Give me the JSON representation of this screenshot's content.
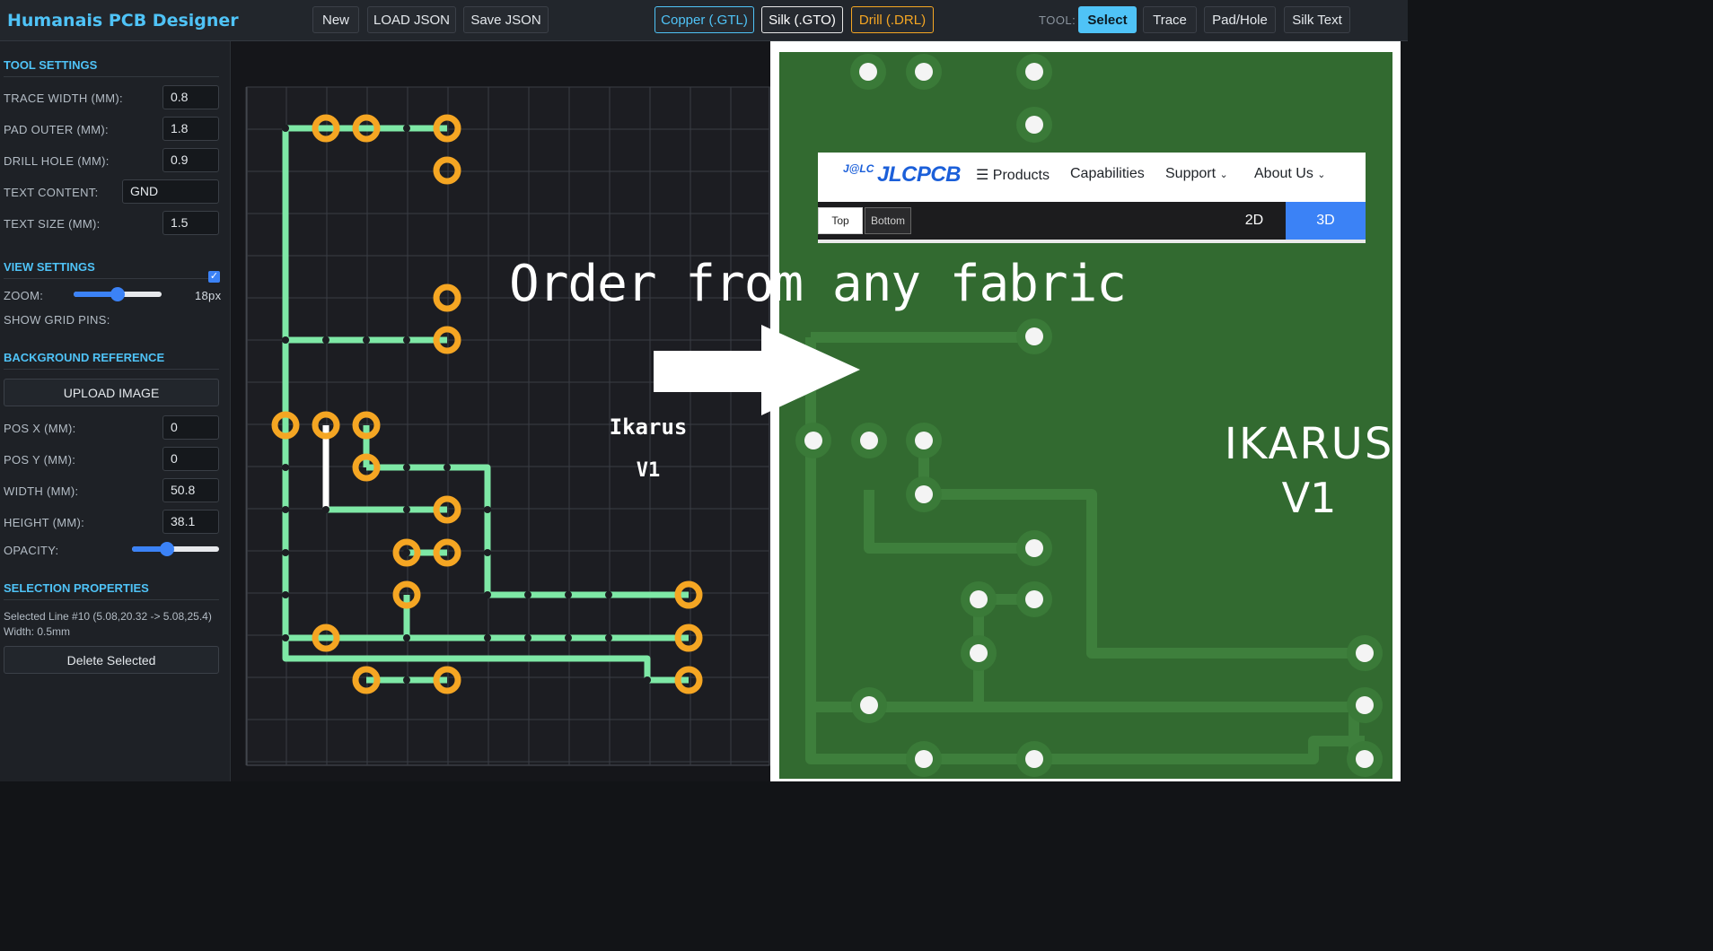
{
  "app": {
    "title": "Humanais PCB Designer"
  },
  "toolbar": {
    "new_label": "New",
    "load_label": "LOAD JSON",
    "save_label": "Save JSON",
    "layers": {
      "copper": "Copper (.GTL)",
      "silk": "Silk (.GTO)",
      "drill": "Drill (.DRL)"
    },
    "tool_label": "TOOL:",
    "tools": {
      "select": "Select",
      "trace": "Trace",
      "pad": "Pad/Hole",
      "silk_text": "Silk Text"
    },
    "active_tool": "Select"
  },
  "sidebar": {
    "tool_settings": {
      "heading": "TOOL SETTINGS",
      "trace_width_label": "TRACE WIDTH (MM):",
      "trace_width": "0.8",
      "pad_outer_label": "PAD OUTER (MM):",
      "pad_outer": "1.8",
      "drill_hole_label": "DRILL HOLE (MM):",
      "drill_hole": "0.9",
      "text_content_label": "TEXT CONTENT:",
      "text_content": "GND",
      "text_size_label": "TEXT SIZE (MM):",
      "text_size": "1.5"
    },
    "view_settings": {
      "heading": "VIEW SETTINGS",
      "zoom_label": "ZOOM:",
      "zoom_value": "18px",
      "zoom_fraction": 0.5,
      "grid_pins_label": "SHOW GRID PINS:",
      "grid_pins_checked": true
    },
    "background_reference": {
      "heading": "BACKGROUND REFERENCE",
      "upload_label": "UPLOAD IMAGE",
      "pos_x_label": "POS X (MM):",
      "pos_x": "0",
      "pos_y_label": "POS Y (MM):",
      "pos_y": "0",
      "width_label": "WIDTH (MM):",
      "width": "50.8",
      "height_label": "HEIGHT (MM):",
      "height": "38.1",
      "opacity_label": "OPACITY:",
      "opacity_fraction": 0.4
    },
    "selection_properties": {
      "heading": "SELECTION PROPERTIES",
      "info_line1": "Selected Line #10 (5.08,20.32 -> 5.08,25.4)",
      "info_line2": "Width: 0.5mm",
      "delete_label": "Delete Selected"
    }
  },
  "canvas": {
    "silk_line1": "Ikarus",
    "silk_line2": "V1",
    "colors": {
      "copper": "#7ee8a6",
      "pad": "#f5a623",
      "selected": "#ffffff",
      "grid": "#3a3d44"
    }
  },
  "render": {
    "silk_line1": "IKARUS",
    "silk_line2": "V1",
    "colors": {
      "board": "#326a30",
      "trace": "#3e7f3c",
      "pad_ring": "#3a7a38"
    }
  },
  "jlcpcb": {
    "logo_badge": "J@LC",
    "logo_text": "JLCPCB",
    "menu": {
      "products": "Products",
      "capabilities": "Capabilities",
      "support": "Support",
      "about": "About Us"
    },
    "side_top": "Top",
    "side_bottom": "Bottom",
    "mode_2d": "2D",
    "mode_3d": "3D",
    "active_mode": "3D"
  },
  "overlay": {
    "headline": "Order from any fabric"
  }
}
